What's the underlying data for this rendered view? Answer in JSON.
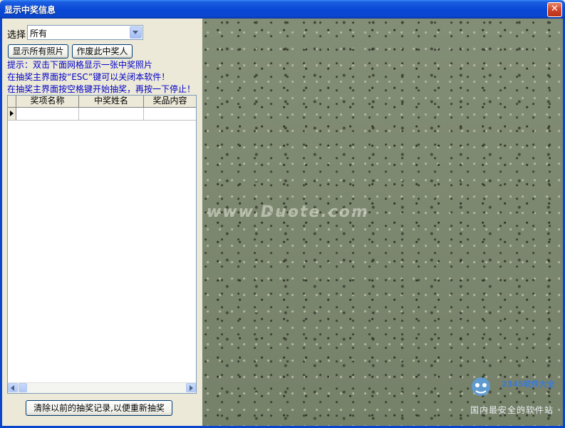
{
  "window": {
    "title": "显示中奖信息",
    "close_glyph": "✕"
  },
  "filter": {
    "label": "选择",
    "selected": "所有"
  },
  "buttons": {
    "show_all_photos": "显示所有照片",
    "void_winner": "作废此中奖人",
    "clear_records": "清除以前的抽奖记录,以便重新抽奖"
  },
  "hints": [
    "提示：双击下面网格显示一张中奖照片",
    "在抽奖主界面按“ESC”键可以关闭本软件！",
    "在抽奖主界面按空格键开始抽奖，再按一下停止！"
  ],
  "grid": {
    "columns": [
      "奖项名称",
      "中奖姓名",
      "奖品内容"
    ]
  },
  "watermark": "www.Duote.com",
  "site_logo": {
    "line1": "2345软件大全",
    "line2": "国内最安全的软件站"
  },
  "colors": {
    "titlebar": "#0a49d6",
    "hint_text": "#0000c8",
    "photo_base": "#7d8870"
  }
}
